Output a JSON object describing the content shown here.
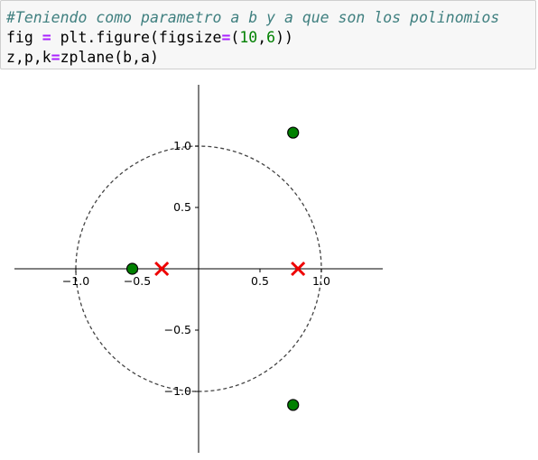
{
  "code_cell": {
    "comment": "#Teniendo como parametro a b y a que son los polinomios",
    "line2": {
      "a": "fig ",
      "op": "=",
      "b": " plt.figure(figsize",
      "op2": "=",
      "c": "(",
      "n1": "10",
      "d": ",",
      "n2": "6",
      "e": "))"
    },
    "line3": {
      "a": "z,p,k",
      "op": "=",
      "b": "zplane(b,a)"
    }
  },
  "colors": {
    "cell_bg": "#f7f7f7",
    "comment": "#408080",
    "operator": "#aa22ff",
    "number": "#008000",
    "zero_fill": "#008000",
    "pole": "#ee0000"
  },
  "chart_data": {
    "type": "scatter",
    "title": "",
    "xlabel": "",
    "ylabel": "",
    "xlim": [
      -1.5,
      1.5
    ],
    "ylim": [
      -1.5,
      1.5
    ],
    "grid": false,
    "unit_circle": {
      "radius": 1,
      "style": "dashed"
    },
    "x_ticks": [
      {
        "value": -1.0,
        "label": "−1.0"
      },
      {
        "value": -0.5,
        "label": "−0.5"
      },
      {
        "value": 0.5,
        "label": "0.5"
      },
      {
        "value": 1.0,
        "label": "1.0"
      }
    ],
    "y_ticks": [
      {
        "value": 1.0,
        "label": "1.0"
      },
      {
        "value": 0.5,
        "label": "0.5"
      },
      {
        "value": -0.5,
        "label": "−0.5"
      },
      {
        "value": -1.0,
        "label": "−1.0"
      }
    ],
    "zeros": [
      {
        "x": -0.54,
        "y": 0.0
      },
      {
        "x": 0.77,
        "y": 1.11
      },
      {
        "x": 0.77,
        "y": -1.11
      }
    ],
    "poles": [
      {
        "x": -0.3,
        "y": 0.0
      },
      {
        "x": 0.81,
        "y": 0.0
      }
    ]
  }
}
